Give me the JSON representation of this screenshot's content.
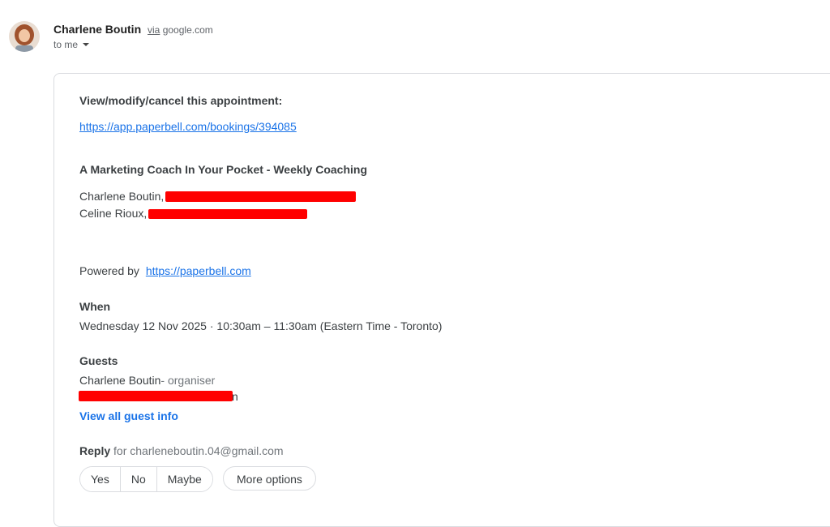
{
  "sender": {
    "name": "Charlene Boutin",
    "via_label": "via",
    "via_domain": "google.com",
    "to": "to me"
  },
  "body": {
    "view_modify_label": "View/modify/cancel this appointment:",
    "booking_url": "https://app.paperbell.com/bookings/394085",
    "event_title": "A Marketing Coach In Your Pocket - Weekly Coaching",
    "participant_1": "Charlene Boutin,",
    "participant_2": "Celine Rioux,",
    "powered_by": "Powered by",
    "powered_url": "https://paperbell.com",
    "when_label": "When",
    "when_value": "Wednesday 12 Nov 2025 · 10:30am – 11:30am (Eastern Time - Toronto)",
    "guests_label": "Guests",
    "guest_1": "Charlene Boutin",
    "guest_1_role": "- organiser",
    "guest_2_tail": "n",
    "view_all_guests": "View all guest info",
    "reply_label": "Reply",
    "reply_for": "for charleneboutin.04@gmail.com"
  },
  "rsvp": {
    "yes": "Yes",
    "no": "No",
    "maybe": "Maybe",
    "more": "More options"
  },
  "colors": {
    "link": "#1a73e8",
    "redaction": "#ff0000"
  }
}
